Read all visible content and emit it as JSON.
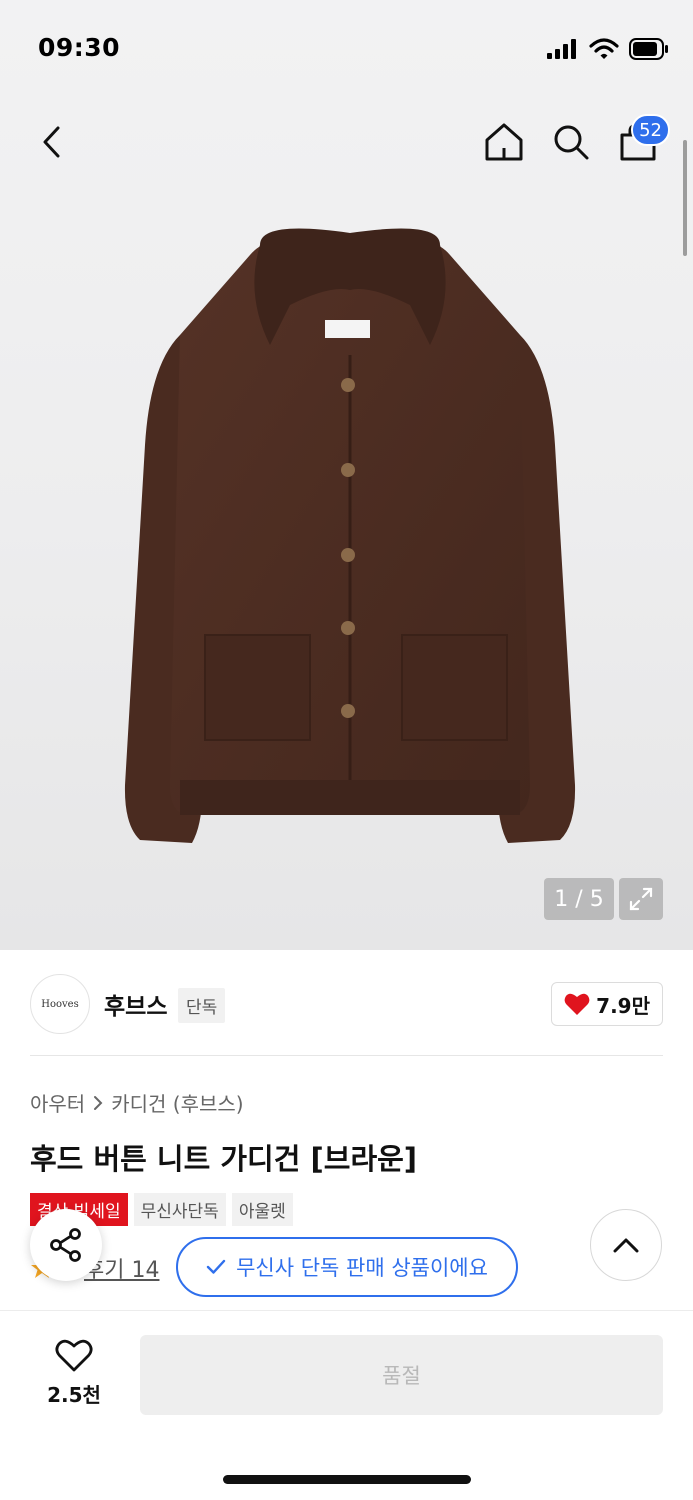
{
  "status_bar": {
    "time": "09:30"
  },
  "nav": {
    "cart_count": "52"
  },
  "gallery": {
    "page_counter": "1 / 5"
  },
  "brand": {
    "logo_text": "Hooves",
    "name": "후브스",
    "tag": "단독",
    "like_count": "7.9만"
  },
  "breadcrumb": {
    "category": "아우터",
    "subcategory": "카디건 (후브스)"
  },
  "product": {
    "title": "후드 버튼 니트 가디건 [브라운]",
    "tags": [
      "결산 빅세일",
      "무신사단독",
      "아울렛"
    ]
  },
  "review": {
    "rating_fragment": "5",
    "review_text": "후기 14"
  },
  "toast": {
    "message": "무신사 단독 판매 상품이에요"
  },
  "bottom_bar": {
    "wish_count": "2.5천",
    "soldout_label": "품절"
  },
  "colors": {
    "accent": "#2f6fec",
    "sale_red": "#e0141e",
    "garment": "#4a2c22"
  }
}
